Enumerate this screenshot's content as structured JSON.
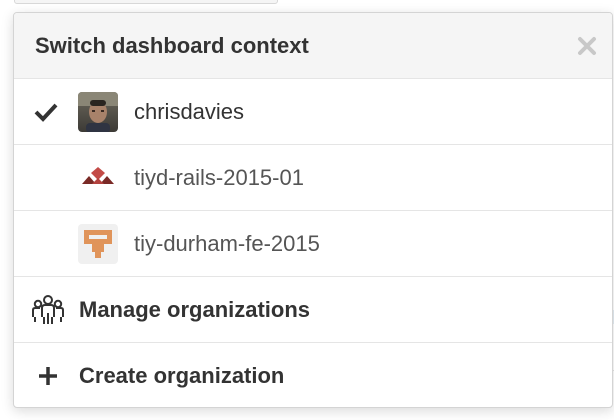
{
  "dropdown": {
    "title": "Switch dashboard context",
    "close_icon": "close-icon",
    "contexts": [
      {
        "label": "chrisdavies",
        "selected": true,
        "avatar": "user-photo-avatar"
      },
      {
        "label": "tiyd-rails-2015-01",
        "selected": false,
        "avatar": "red-triangles-org-avatar"
      },
      {
        "label": "tiy-durham-fe-2015",
        "selected": false,
        "avatar": "orange-identicon-org-avatar"
      }
    ],
    "actions": [
      {
        "label": "Manage organizations",
        "icon": "organization-icon"
      },
      {
        "label": "Create organization",
        "icon": "plus-icon"
      }
    ]
  },
  "colors": {
    "header_bg": "#f5f5f5",
    "text": "#333333",
    "border": "#e5e5e5",
    "org_red": "#7a2a26",
    "org_orange": "#e0945a"
  }
}
